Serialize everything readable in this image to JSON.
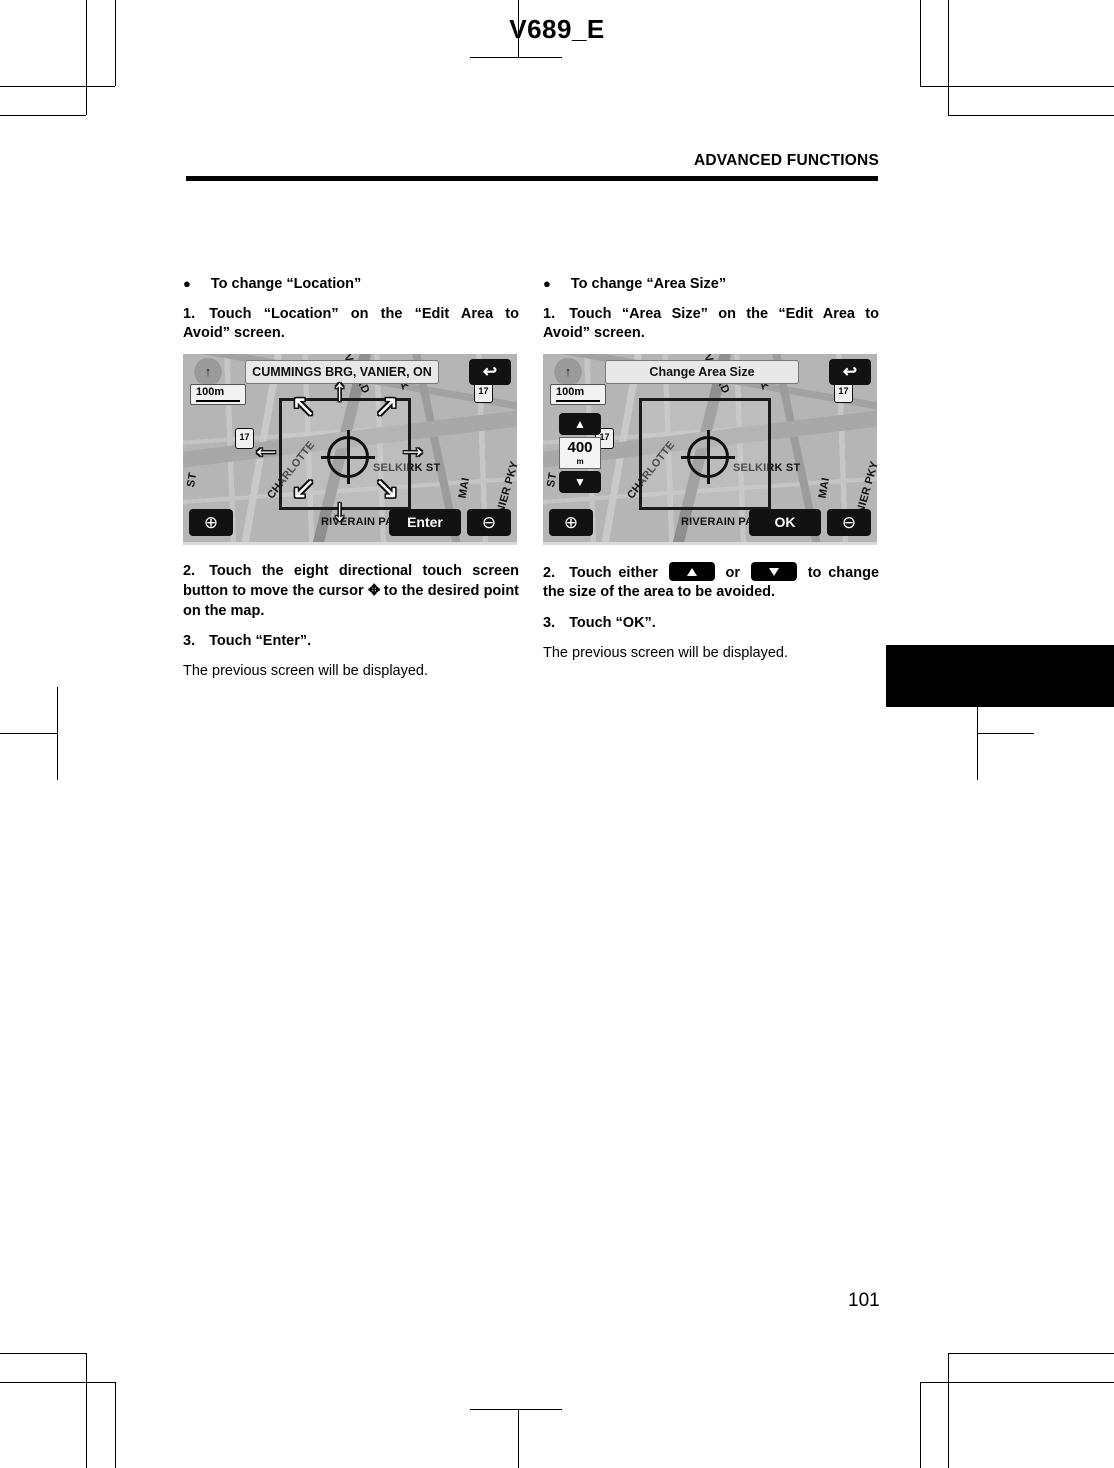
{
  "header": {
    "doc_code": "V689_E",
    "section_title": "ADVANCED FUNCTIONS"
  },
  "page_number": "101",
  "left_column": {
    "bullet_dot": "●",
    "bullet_heading": "To change “Location”",
    "step1_num": "1.",
    "step1_text": "Touch “Location” on the “Edit Area to Avoid” screen.",
    "step2_num": "2.",
    "step2_text_before": "Touch the eight directional touch screen button to move the cursor",
    "step2_cursor_glyph": "✥",
    "step2_text_after": "to the desired point on the map.",
    "step3_num": "3.",
    "step3_text": "Touch “Enter”.",
    "note": "The previous screen will be displayed.",
    "screenshot": {
      "title": "CUMMINGS BRG, VANIER, ON",
      "back_icon": "↩",
      "compass_icon": "↑",
      "scale": "100m",
      "zoom_in": "⊕",
      "zoom_out": "⊖",
      "action_label": "Enter",
      "arrows": {
        "n": "↑",
        "s": "↓",
        "w": "←",
        "e": "→",
        "nw": "↖",
        "ne": "↗",
        "sw": "↙",
        "se": "↘"
      },
      "roads": {
        "selkirk": "SELKIRK ST",
        "riverain": "RIVERAIN PARK",
        "charlotte": "CHARLOTTE",
        "vanier": "VANIER PKY",
        "ay_ave": "AY AVE",
        "verad": "VER RD",
        "st": "ST",
        "mai": "MAI"
      },
      "shield_a": "17",
      "shield_b": "17"
    }
  },
  "right_column": {
    "bullet_dot": "●",
    "bullet_heading": "To change “Area Size”",
    "step1_num": "1.",
    "step1_text": "Touch “Area Size” on the “Edit Area to Avoid” screen.",
    "step2_num": "2.",
    "step2_text_before": "Touch either",
    "step2_text_middle": "or",
    "step2_text_after": "to change the size of the area to be avoided.",
    "step3_num": "3.",
    "step3_text": "Touch “OK”.",
    "note": "The previous screen will be displayed.",
    "screenshot": {
      "title": "Change Area Size",
      "back_icon": "↩",
      "compass_icon": "↑",
      "scale": "100m",
      "size_up_icon": "▲",
      "size_value": "400",
      "size_unit": "m",
      "size_down_icon": "▼",
      "zoom_in": "⊕",
      "zoom_out": "⊖",
      "action_label": "OK",
      "roads": {
        "selkirk": "SELKIRK ST",
        "riverain": "RIVERAIN PARK",
        "charlotte": "CHARLOTTE",
        "vanier": "VANIER PKY",
        "ay_ave": "AY AVE",
        "verad": "VER RD",
        "st": "ST",
        "mai": "MAI"
      },
      "shield_a": "17",
      "shield_b": "17"
    }
  }
}
